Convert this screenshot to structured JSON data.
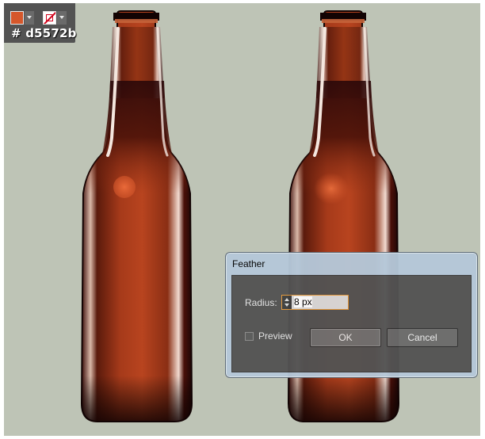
{
  "swatches": {
    "fill_color": "#d5572b",
    "fill_label": "fill-swatch",
    "stroke_label": "stroke-swatch-none",
    "hex_text": "# d5572b"
  },
  "dialog": {
    "title": "Feather",
    "radius_label": "Radius:",
    "radius_value": "8 px",
    "preview_label": "Preview",
    "preview_checked": false,
    "ok_label": "OK",
    "cancel_label": "Cancel"
  },
  "colors": {
    "canvas": "#bec4b6",
    "bottle_glass": "#7e2b12",
    "bottle_dark": "#2a0809",
    "bottle_light": "#b4401e",
    "highlight": "#d5572b",
    "panel": "#535353",
    "focus_border": "#e59a3c"
  }
}
